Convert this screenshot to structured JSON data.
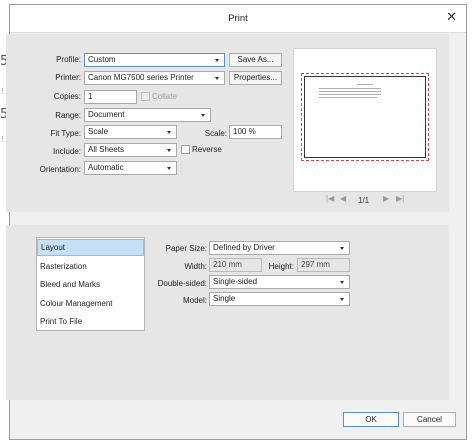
{
  "background_fragments": [
    "5",
    "5"
  ],
  "window": {
    "title": "Print"
  },
  "profile": {
    "label": "Profile:",
    "value": "Custom",
    "save_as": "Save As..."
  },
  "printer": {
    "label": "Printer:",
    "value": "Canon MG7500 series Printer",
    "properties": "Properties..."
  },
  "copies": {
    "label": "Copies:",
    "value": "1",
    "collate_label": "Collate",
    "collate_checked": false
  },
  "range": {
    "label": "Range:",
    "value": "Document"
  },
  "fit_type": {
    "label": "Fit Type:",
    "value": "Scale"
  },
  "scale": {
    "label": "Scale:",
    "value": "100 %"
  },
  "include": {
    "label": "Include:",
    "value": "All Sheets",
    "reverse_label": "Reverse",
    "reverse_checked": false
  },
  "orientation": {
    "label": "Orientation:",
    "value": "Automatic"
  },
  "preview_nav": {
    "first": "|◀",
    "prev": "◀",
    "page": "1/1",
    "next": "▶",
    "last": "▶|"
  },
  "categories": [
    "Layout",
    "Rasterization",
    "Bleed and Marks",
    "Colour Management",
    "Print To File"
  ],
  "selected_category": "Layout",
  "layout": {
    "paper_size_label": "Paper Size:",
    "paper_size": "Defined by Driver",
    "width_label": "Width:",
    "width": "210 mm",
    "height_label": "Height:",
    "height": "297 mm",
    "double_sided_label": "Double-sided:",
    "double_sided": "Single-sided",
    "model_label": "Model:",
    "model": "Single"
  },
  "footer": {
    "ok": "OK",
    "cancel": "Cancel"
  },
  "colors": {
    "accent": "#5a8fd6",
    "selection": "#c6e0f7",
    "panel": "#e6e6e6",
    "bleed": "#d04848"
  }
}
